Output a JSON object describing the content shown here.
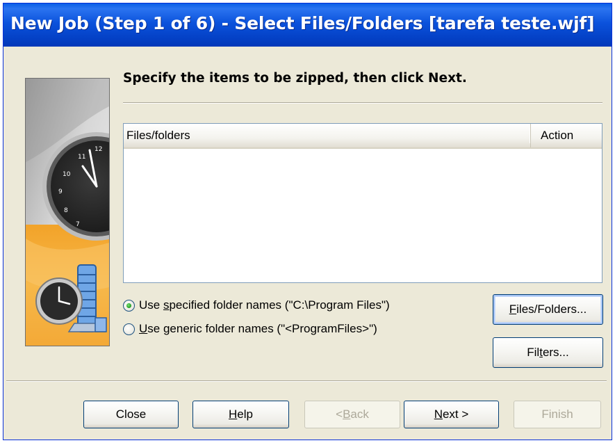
{
  "window": {
    "title": "New Job (Step 1 of 6) - Select Files/Folders [tarefa teste.wjf]"
  },
  "main": {
    "heading": "Specify the items to be zipped, then click Next."
  },
  "listview": {
    "columns": [
      "Files/folders",
      "Action"
    ],
    "rows": []
  },
  "options": {
    "specified": {
      "pre": "Use ",
      "accel": "s",
      "post": "pecified folder names (\"C:\\Program Files\")",
      "checked": true
    },
    "generic": {
      "pre": "",
      "accel": "U",
      "post": "se generic folder names (\"<ProgramFiles>\")",
      "checked": false
    }
  },
  "buttons": {
    "files_folders": {
      "pre": "",
      "accel": "F",
      "post": "iles/Folders..."
    },
    "filters": {
      "pre": "Fil",
      "accel": "t",
      "post": "ers..."
    },
    "close": {
      "label": "Close"
    },
    "help": {
      "pre": "",
      "accel": "H",
      "post": "elp"
    },
    "back": {
      "pre": "< ",
      "accel": "B",
      "post": "ack"
    },
    "next": {
      "pre": "",
      "accel": "N",
      "post": "ext >"
    },
    "finish": {
      "label": "Finish"
    }
  },
  "colors": {
    "titlebar": "#0b52dc",
    "dialog_bg": "#ece9d8",
    "side_orange": "#f4a92e",
    "radio_checked": "#29a229"
  },
  "icons": {
    "side_clock": "clock-icon",
    "zip_clock": "zip-clock-icon"
  }
}
